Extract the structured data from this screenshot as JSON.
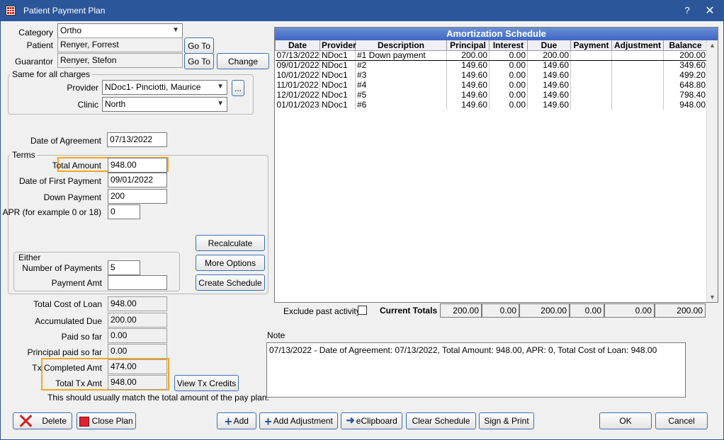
{
  "window": {
    "title": "Patient Payment Plan",
    "help": "?",
    "close": "✕"
  },
  "form": {
    "category_label": "Category",
    "category_value": "Ortho",
    "patient_label": "Patient",
    "patient_value": "Renyer, Forrest",
    "guarantor_label": "Guarantor",
    "guarantor_value": "Renyer, Stefon",
    "goto_label": "Go To",
    "change_label": "Change",
    "same_group": "Same for all charges",
    "provider_label": "Provider",
    "provider_value": "NDoc1- Pinciotti, Maurice",
    "ellipsis": "...",
    "clinic_label": "Clinic",
    "clinic_value": "North",
    "date_agreement_label": "Date of Agreement",
    "date_agreement_value": "07/13/2022",
    "terms_group": "Terms",
    "total_amount_label": "Total Amount",
    "total_amount_value": "948.00",
    "first_payment_label": "Date of First Payment",
    "first_payment_value": "09/01/2022",
    "down_payment_label": "Down Payment",
    "down_payment_value": "200",
    "apr_label": "APR (for example 0 or 18)",
    "apr_value": "0",
    "recalc_label": "Recalculate",
    "more_options_label": "More Options",
    "create_schedule_label": "Create Schedule",
    "either_group": "Either",
    "num_payments_label": "Number of Payments",
    "num_payments_value": "5",
    "payment_amt_label": "Payment Amt",
    "payment_amt_value": "",
    "total_cost_label": "Total Cost of Loan",
    "total_cost_value": "948.00",
    "accum_due_label": "Accumulated Due",
    "accum_due_value": "200.00",
    "paid_so_far_label": "Paid so far",
    "paid_so_far_value": "0.00",
    "principal_paid_label": "Principal paid so far",
    "principal_paid_value": "0.00",
    "tx_completed_label": "Tx Completed Amt",
    "tx_completed_value": "474.00",
    "total_tx_label": "Total Tx Amt",
    "total_tx_value": "948.00",
    "view_tx_credits_label": "View Tx Credits",
    "match_note": "This should usually match the total amount of the pay plan."
  },
  "schedule": {
    "title": "Amortization Schedule",
    "columns": [
      "Date",
      "Provider",
      "Description",
      "Principal",
      "Interest",
      "Due",
      "Payment",
      "Adjustment",
      "Balance"
    ],
    "rows": [
      [
        "07/13/2022",
        "NDoc1",
        "#1 Down payment",
        "200.00",
        "0.00",
        "200.00",
        "",
        "",
        "200.00"
      ],
      [
        "09/01/2022",
        "NDoc1",
        "#2",
        "149.60",
        "0.00",
        "149.60",
        "",
        "",
        "349.60"
      ],
      [
        "10/01/2022",
        "NDoc1",
        "#3",
        "149.60",
        "0.00",
        "149.60",
        "",
        "",
        "499.20"
      ],
      [
        "11/01/2022",
        "NDoc1",
        "#4",
        "149.60",
        "0.00",
        "149.60",
        "",
        "",
        "648.80"
      ],
      [
        "12/01/2022",
        "NDoc1",
        "#5",
        "149.60",
        "0.00",
        "149.60",
        "",
        "",
        "798.40"
      ],
      [
        "01/01/2023",
        "NDoc1",
        "#6",
        "149.60",
        "0.00",
        "149.60",
        "",
        "",
        "948.00"
      ]
    ],
    "exclude_past_label": "Exclude past activity",
    "current_totals_label": "Current Totals",
    "totals": [
      "200.00",
      "0.00",
      "200.00",
      "0.00",
      "0.00",
      "200.00"
    ]
  },
  "note": {
    "label": "Note",
    "text": "07/13/2022 - Date of Agreement: 07/13/2022, Total Amount: 948.00, APR: 0, Total Cost of Loan: 948.00"
  },
  "buttons": {
    "delete": "Delete",
    "close_plan": "Close Plan",
    "add": "Add",
    "add_adjustment": "Add Adjustment",
    "eclipboard": "eClipboard",
    "clear_schedule": "Clear Schedule",
    "sign_print": "Sign & Print",
    "ok": "OK",
    "cancel": "Cancel"
  },
  "icons": {
    "delete": "close-x-icon",
    "close_plan": "close-plan-icon",
    "add": "plus-icon",
    "eclipboard": "arrow-right-icon"
  },
  "colors": {
    "titlebar": "#2b579a",
    "highlight": "#f5a623",
    "grid_header": "#3e66c4",
    "delete_icon": "#d21f1f"
  }
}
